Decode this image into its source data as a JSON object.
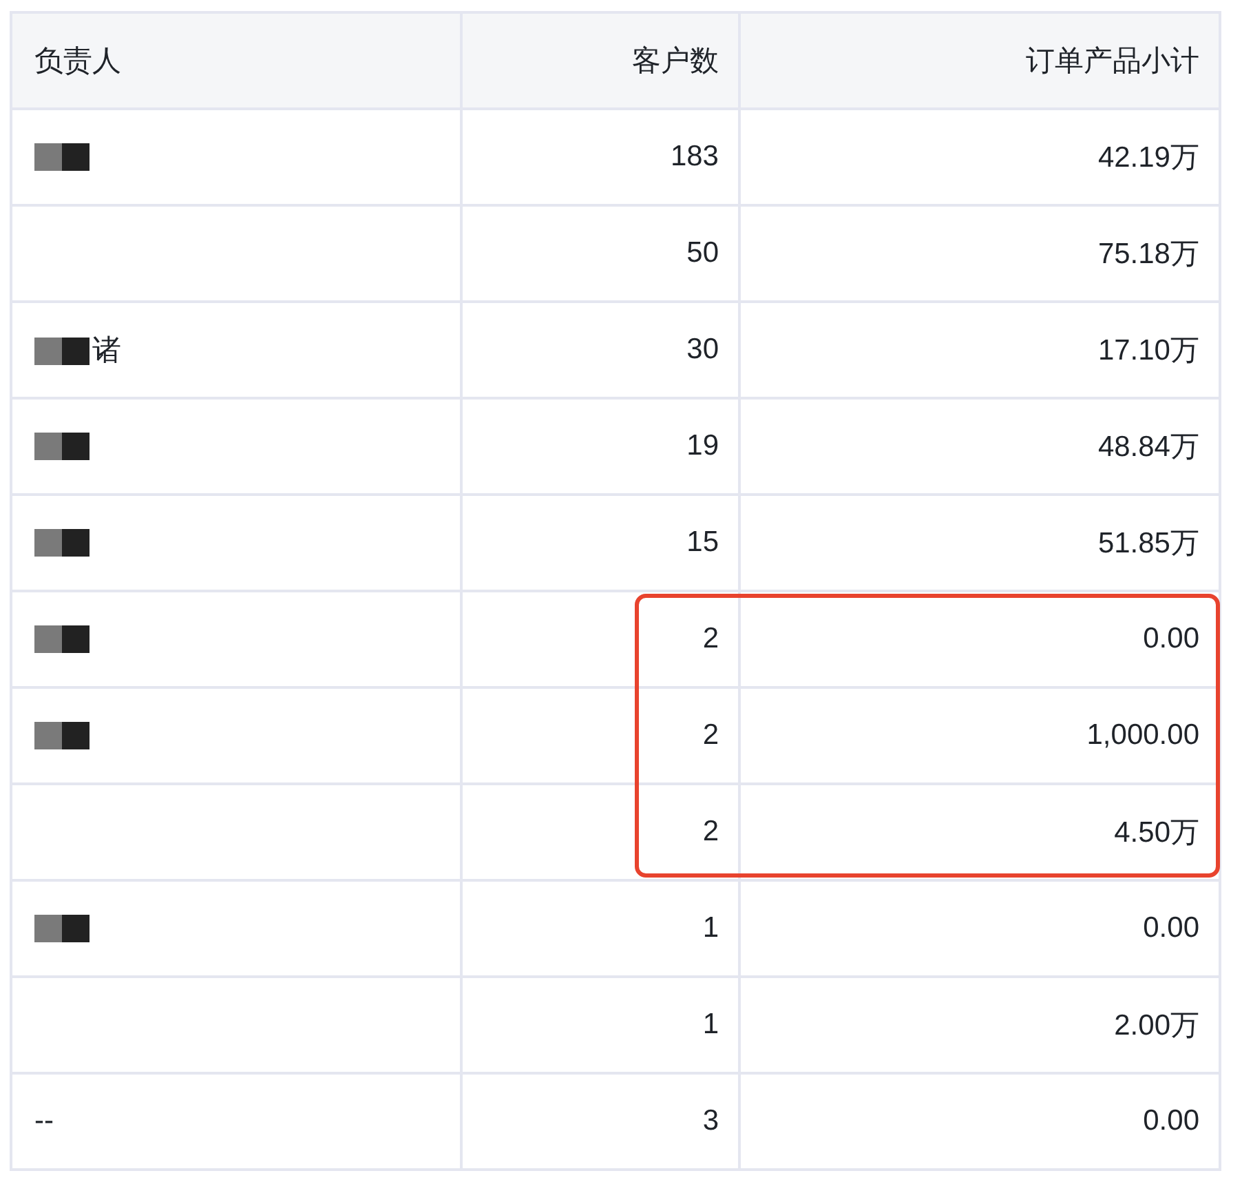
{
  "table": {
    "columns": [
      "负责人",
      "客户数",
      "订单产品小计"
    ],
    "rows": [
      {
        "cells": [
          "",
          "183",
          "42.19万"
        ],
        "redacted": true,
        "highlighted": false
      },
      {
        "cells": [
          "",
          "50",
          "75.18万"
        ],
        "redacted": false,
        "highlighted": false
      },
      {
        "cells": [
          "诸",
          "30",
          "17.10万"
        ],
        "redacted": true,
        "highlighted": false
      },
      {
        "cells": [
          "",
          "19",
          "48.84万"
        ],
        "redacted": true,
        "highlighted": false
      },
      {
        "cells": [
          "",
          "15",
          "51.85万"
        ],
        "redacted": true,
        "highlighted": false
      },
      {
        "cells": [
          "",
          "2",
          "0.00"
        ],
        "redacted": true,
        "highlighted": true
      },
      {
        "cells": [
          "",
          "2",
          "1,000.00"
        ],
        "redacted": true,
        "highlighted": true
      },
      {
        "cells": [
          "",
          "2",
          "4.50万"
        ],
        "redacted": false,
        "highlighted": true
      },
      {
        "cells": [
          "",
          "1",
          "0.00"
        ],
        "redacted": true,
        "highlighted": false
      },
      {
        "cells": [
          "",
          "1",
          "2.00万"
        ],
        "redacted": false,
        "highlighted": false
      },
      {
        "cells": [
          "--",
          "3",
          "0.00"
        ],
        "redacted": false,
        "highlighted": false
      }
    ]
  }
}
